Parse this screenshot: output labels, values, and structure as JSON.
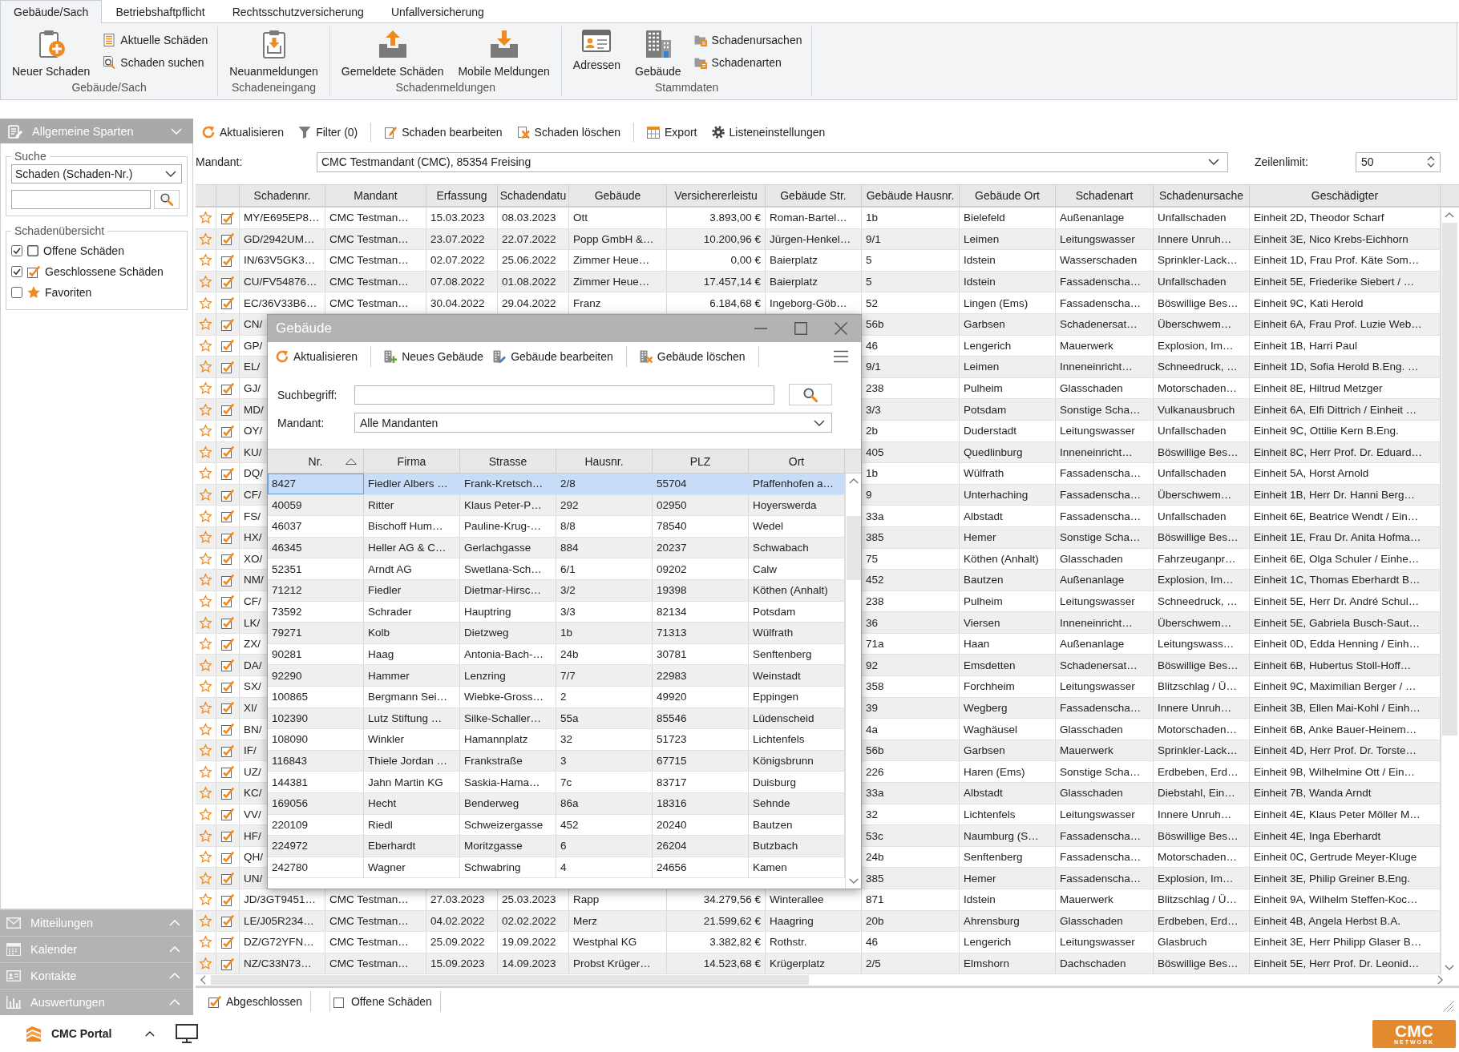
{
  "tabs": [
    {
      "label": "Gebäude/Sach",
      "selected": true
    },
    {
      "label": "Betriebshaftpflicht",
      "selected": false
    },
    {
      "label": "Rechtsschutzversicherung",
      "selected": false
    },
    {
      "label": "Unfallversicherung",
      "selected": false
    }
  ],
  "ribbon": [
    {
      "label": "Gebäude/Sach",
      "buttons": [
        {
          "label": "Neuer Schaden",
          "kind": "large"
        },
        {
          "label": "Aktuelle Schäden",
          "kind": "small"
        },
        {
          "label": "Schaden suchen",
          "kind": "small"
        }
      ]
    },
    {
      "label": "Schadeneingang",
      "buttons": [
        {
          "label": "Neuanmeldungen",
          "kind": "large"
        }
      ]
    },
    {
      "label": "Schadenmeldungen",
      "buttons": [
        {
          "label": "Gemeldete Schäden",
          "kind": "large"
        },
        {
          "label": "Mobile Meldungen",
          "kind": "large"
        }
      ]
    },
    {
      "label": "Stammdaten",
      "buttons": [
        {
          "label": "Adressen",
          "kind": "large"
        },
        {
          "label": "Gebäude",
          "kind": "large"
        },
        {
          "label": "Schadenursachen",
          "kind": "small"
        },
        {
          "label": "Schadenarten",
          "kind": "small"
        }
      ]
    }
  ],
  "sidebar": {
    "title": "Allgemeine Sparten",
    "search": {
      "title": "Suche",
      "field": "Schaden (Schaden-Nr.)"
    },
    "overview": {
      "title": "Schadenübersicht",
      "items": [
        {
          "label": "Offene Schäden",
          "checked": true
        },
        {
          "label": "Geschlossene Schäden",
          "checked": true
        },
        {
          "label": "Favoriten",
          "checked": false
        }
      ]
    },
    "sections": [
      "Mitteilungen",
      "Kalender",
      "Kontakte",
      "Auswertungen"
    ]
  },
  "toolbar": [
    [
      "Aktualisieren",
      "Filter (0)"
    ],
    [
      "Schaden bearbeiten",
      "Schaden löschen"
    ],
    [
      "Export",
      "Listeneinstellungen"
    ]
  ],
  "filter_bar": {
    "mandant_label": "Mandant:",
    "mandant": "CMC Testmandant (CMC), 85354 Freising",
    "row_limit_label": "Zeilenlimit:",
    "row_limit": "50"
  },
  "table": {
    "columns": [
      "Schadennr.",
      "Mandant",
      "Erfassung",
      "Schadendatu",
      "Gebäude",
      "Versichererleistu",
      "Gebäude Str.",
      "Gebäude Hausnr.",
      "Gebäude Ort",
      "Schadenart",
      "Schadenursache",
      "Geschädigter"
    ],
    "rows": [
      {
        "favorite": false,
        "checked": true,
        "kind": "full",
        "cells": [
          "MY/E695EP8…",
          "CMC Testman…",
          "15.03.2023",
          "08.03.2023",
          "Ott",
          "3.893,00 €",
          "Roman-Bartel…",
          "1b",
          "Bielefeld",
          "Außenanlage",
          "Unfallschaden",
          "Einheit 2D, Theodor Scharf"
        ]
      },
      {
        "favorite": false,
        "checked": true,
        "kind": "full",
        "cells": [
          "GD/2942UM…",
          "CMC Testman…",
          "23.07.2022",
          "22.07.2022",
          "Popp GmbH &…",
          "10.200,96 €",
          "Jürgen-Henkel…",
          "9/1",
          "Leimen",
          "Leitungswasser",
          "Innere Unruh…",
          "Einheit 3E, Nico Krebs-Eichhorn"
        ]
      },
      {
        "favorite": false,
        "checked": true,
        "kind": "full",
        "cells": [
          "IN/63V5GK3…",
          "CMC Testman…",
          "02.07.2022",
          "25.06.2022",
          "Zimmer Heue…",
          "0,00 €",
          "Baierplatz",
          "5",
          "Idstein",
          "Wasserschaden",
          "Sprinkler-Lack…",
          "Einheit 1D, Frau Prof. Käte Som…"
        ]
      },
      {
        "favorite": false,
        "checked": true,
        "kind": "full",
        "cells": [
          "CU/FV54876…",
          "CMC Testman…",
          "07.08.2022",
          "01.08.2022",
          "Zimmer Heue…",
          "17.457,14 €",
          "Baierplatz",
          "5",
          "Idstein",
          "Fassadenscha…",
          "Unfallschaden",
          "Einheit 5E, Friederike Siebert / …"
        ]
      },
      {
        "favorite": false,
        "checked": true,
        "kind": "full",
        "cells": [
          "EC/36V33B6…",
          "CMC Testman…",
          "30.04.2022",
          "29.04.2022",
          "Franz",
          "6.184,68 €",
          "Ingeborg-Göb…",
          "52",
          "Lingen (Ems)",
          "Fassadenscha…",
          "Böswillige Bes…",
          "Einheit 9C, Kati Herold"
        ]
      },
      {
        "favorite": false,
        "checked": true,
        "kind": "covered",
        "cells": [
          "CN/",
          "56b",
          "Garbsen",
          "Schadenersat…",
          "Überschwem…",
          "Einheit 6A, Frau Prof. Luzie Web…"
        ]
      },
      {
        "favorite": false,
        "checked": true,
        "kind": "covered",
        "cells": [
          "GP/",
          "46",
          "Lengerich",
          "Mauerwerk",
          "Explosion, Im…",
          "Einheit 1B, Harri Paul"
        ]
      },
      {
        "favorite": false,
        "checked": true,
        "kind": "covered",
        "cells": [
          "EL/",
          "9/1",
          "Leimen",
          "Inneneinricht…",
          "Schneedruck, …",
          "Einheit 1D, Sofia Herold B.Eng. …"
        ]
      },
      {
        "favorite": false,
        "checked": true,
        "kind": "covered",
        "cells": [
          "GJ/",
          "238",
          "Pulheim",
          "Glasschaden",
          "Motorschaden…",
          "Einheit 8E, Hiltrud Metzger"
        ]
      },
      {
        "favorite": false,
        "checked": true,
        "kind": "covered",
        "cells": [
          "MD/",
          "3/3",
          "Potsdam",
          "Sonstige Scha…",
          "Vulkanausbruch",
          "Einheit 6A, Elfi Dittrich / Einheit …"
        ]
      },
      {
        "favorite": false,
        "checked": true,
        "kind": "covered",
        "cells": [
          "OY/",
          "2b",
          "Duderstadt",
          "Leitungswasser",
          "Unfallschaden",
          "Einheit 9C, Ottilie Kern B.Eng."
        ]
      },
      {
        "favorite": false,
        "checked": true,
        "kind": "covered",
        "cells": [
          "KU/",
          "405",
          "Quedlinburg",
          "Inneneinricht…",
          "Böswillige Bes…",
          "Einheit 8C, Herr Prof. Dr. Eduard…"
        ]
      },
      {
        "favorite": false,
        "checked": true,
        "kind": "covered",
        "cells": [
          "DQ/",
          "1b",
          "Wülfrath",
          "Fassadenscha…",
          "Unfallschaden",
          "Einheit 5A, Horst Arnold"
        ]
      },
      {
        "favorite": false,
        "checked": true,
        "kind": "covered",
        "cells": [
          "CF/",
          "9",
          "Unterhaching",
          "Fassadenscha…",
          "Überschwem…",
          "Einheit 1B, Herr Dr. Hanni Berg…"
        ]
      },
      {
        "favorite": false,
        "checked": true,
        "kind": "covered",
        "cells": [
          "FS/",
          "33a",
          "Albstadt",
          "Fassadenscha…",
          "Unfallschaden",
          "Einheit 6E, Beatrice Wendt / Ein…"
        ]
      },
      {
        "favorite": false,
        "checked": true,
        "kind": "covered",
        "cells": [
          "HX/",
          "385",
          "Hemer",
          "Sonstige Scha…",
          "Böswillige Bes…",
          "Einheit 1E, Frau Dr. Anita Hofma…"
        ]
      },
      {
        "favorite": false,
        "checked": true,
        "kind": "covered",
        "cells": [
          "XO/",
          "75",
          "Köthen (Anhalt)",
          "Glasschaden",
          "Fahrzeuganpr…",
          "Einheit 6E, Olga Schuler / Einhe…"
        ]
      },
      {
        "favorite": false,
        "checked": true,
        "kind": "covered",
        "cells": [
          "NM/",
          "452",
          "Bautzen",
          "Außenanlage",
          "Explosion, Im…",
          "Einheit 1C, Thomas Eberhardt B…"
        ]
      },
      {
        "favorite": false,
        "checked": true,
        "kind": "covered",
        "cells": [
          "CF/",
          "238",
          "Pulheim",
          "Leitungswasser",
          "Schneedruck, …",
          "Einheit 5E, Herr Dr. André Schul…"
        ]
      },
      {
        "favorite": false,
        "checked": true,
        "kind": "covered",
        "cells": [
          "LK/",
          "36",
          "Viersen",
          "Inneneinricht…",
          "Überschwem…",
          "Einheit 5E, Gabriela Busch-Saut…"
        ]
      },
      {
        "favorite": false,
        "checked": true,
        "kind": "covered",
        "cells": [
          "ZX/",
          "71a",
          "Haan",
          "Außenanlage",
          "Leitungswass…",
          "Einheit 0D, Edda Henning / Einh…"
        ]
      },
      {
        "favorite": false,
        "checked": true,
        "kind": "covered",
        "cells": [
          "DA/",
          "92",
          "Emsdetten",
          "Schadenersat…",
          "Böswillige Bes…",
          "Einheit 6B, Hubertus Stoll-Hoff…"
        ]
      },
      {
        "favorite": false,
        "checked": true,
        "kind": "covered",
        "cells": [
          "SX/",
          "358",
          "Forchheim",
          "Leitungswasser",
          "Blitzschlag / Ü…",
          "Einheit 9C, Maximilian Berger / …"
        ]
      },
      {
        "favorite": false,
        "checked": true,
        "kind": "covered",
        "cells": [
          "XI/",
          "39",
          "Wegberg",
          "Fassadenscha…",
          "Innere Unruh…",
          "Einheit 3B, Ellen Mai-Kohl / Einh…"
        ]
      },
      {
        "favorite": false,
        "checked": true,
        "kind": "covered",
        "cells": [
          "BN/",
          "4a",
          "Waghäusel",
          "Glasschaden",
          "Motorschaden…",
          "Einheit 6B, Anke Bauer-Heinem…"
        ]
      },
      {
        "favorite": false,
        "checked": true,
        "kind": "covered",
        "cells": [
          "IF/",
          "56b",
          "Garbsen",
          "Mauerwerk",
          "Sprinkler-Lack…",
          "Einheit 4D, Herr Prof. Dr. Torste…"
        ]
      },
      {
        "favorite": false,
        "checked": true,
        "kind": "covered",
        "cells": [
          "UZ/",
          "226",
          "Haren (Ems)",
          "Sonstige Scha…",
          "Erdbeben, Erd…",
          "Einheit 9B, Wilhelmine Ott / Ein…"
        ]
      },
      {
        "favorite": false,
        "checked": true,
        "kind": "covered",
        "cells": [
          "KC/",
          "33a",
          "Albstadt",
          "Glasschaden",
          "Diebstahl, Ein…",
          "Einheit 7B, Wanda Arndt"
        ]
      },
      {
        "favorite": false,
        "checked": true,
        "kind": "covered",
        "cells": [
          "VV/",
          "32",
          "Lichtenfels",
          "Leitungswasser",
          "Innere Unruh…",
          "Einheit 4E, Klaus Peter Möller M…"
        ]
      },
      {
        "favorite": false,
        "checked": true,
        "kind": "covered",
        "cells": [
          "HF/",
          "53c",
          "Naumburg (S…",
          "Fassadenscha…",
          "Böswillige Bes…",
          "Einheit 4E, Inga Eberhardt"
        ]
      },
      {
        "favorite": false,
        "checked": true,
        "kind": "covered",
        "cells": [
          "QH/",
          "24b",
          "Senftenberg",
          "Fassadenscha…",
          "Motorschaden…",
          "Einheit 0C, Gertrude Meyer-Kluge"
        ]
      },
      {
        "favorite": false,
        "checked": true,
        "kind": "covered",
        "cells": [
          "UN/",
          "385",
          "Hemer",
          "Fassadenscha…",
          "Explosion, Im…",
          "Einheit 3E, Philip Greiner B.Eng."
        ]
      },
      {
        "favorite": false,
        "checked": true,
        "kind": "full",
        "cells": [
          "JD/3GT9451…",
          "CMC Testman…",
          "27.03.2023",
          "25.03.2023",
          "Rapp",
          "34.279,56 €",
          "Winterallee",
          "871",
          "Idstein",
          "Mauerwerk",
          "Blitzschlag / Ü…",
          "Einheit 9A, Wilhelm Steffen-Koc…"
        ]
      },
      {
        "favorite": false,
        "checked": true,
        "kind": "full",
        "cells": [
          "LE/J05R234…",
          "CMC Testman…",
          "04.02.2022",
          "02.02.2022",
          "Merz",
          "21.599,62 €",
          "Haagring",
          "20b",
          "Ahrensburg",
          "Glasschaden",
          "Erdbeben, Erd…",
          "Einheit 4B, Angela Herbst B.A."
        ]
      },
      {
        "favorite": false,
        "checked": true,
        "kind": "full",
        "cells": [
          "DZ/G72YFN…",
          "CMC Testman…",
          "25.09.2022",
          "19.09.2022",
          "Westphal KG",
          "3.382,82 €",
          "Rothstr.",
          "46",
          "Lengerich",
          "Leitungswasser",
          "Glasbruch",
          "Einheit 3E, Herr Philipp Glaser B…"
        ]
      },
      {
        "favorite": false,
        "checked": true,
        "kind": "full",
        "cells": [
          "NZ/C33N73…",
          "CMC Testman…",
          "15.09.2023",
          "14.09.2023",
          "Probst Krüger…",
          "14.523,68 €",
          "Krügerplatz",
          "2/5",
          "Elmshorn",
          "Dachschaden",
          "Böswillige Bes…",
          "Einheit 5E, Herr Prof. Dr. Leonid…"
        ]
      }
    ]
  },
  "status_bar": [
    {
      "label": "Abgeschlossen",
      "checked": true
    },
    {
      "label": "Offene Schäden",
      "checked": false
    }
  ],
  "dialog": {
    "title": "Gebäude",
    "toolbar": [
      [
        "Aktualisieren"
      ],
      [
        "Neues Gebäude",
        "Gebäude bearbeiten"
      ],
      [
        "Gebäude löschen"
      ]
    ],
    "search_label": "Suchbegriff:",
    "mandant_label": "Mandant:",
    "mandant": "Alle Mandanten",
    "table": {
      "columns": [
        {
          "label": "Nr.",
          "sorted": true
        },
        {
          "label": "Firma",
          "sorted": false
        },
        {
          "label": "Strasse",
          "sorted": false
        },
        {
          "label": "Hausnr.",
          "sorted": false
        },
        {
          "label": "PLZ",
          "sorted": false
        },
        {
          "label": "Ort",
          "sorted": false
        }
      ],
      "rows": [
        {
          "selected": true,
          "cells": [
            "8427",
            "Fiedler Albers …",
            "Frank-Kretsch…",
            "2/8",
            "55704",
            "Pfaffenhofen a…"
          ]
        },
        {
          "selected": false,
          "cells": [
            "40059",
            "Ritter",
            "Klaus Peter-P…",
            "292",
            "02950",
            "Hoyerswerda"
          ]
        },
        {
          "selected": false,
          "cells": [
            "46037",
            "Bischoff Hum…",
            "Pauline-Krug-…",
            "8/8",
            "78540",
            "Wedel"
          ]
        },
        {
          "selected": false,
          "cells": [
            "46345",
            "Heller AG & C…",
            "Gerlachgasse",
            "884",
            "20237",
            "Schwabach"
          ]
        },
        {
          "selected": false,
          "cells": [
            "52351",
            "Arndt AG",
            "Swetlana-Sch…",
            "6/1",
            "09202",
            "Calw"
          ]
        },
        {
          "selected": false,
          "cells": [
            "71212",
            "Fiedler",
            "Dietmar-Hirsc…",
            "3/2",
            "19398",
            "Köthen (Anhalt)"
          ]
        },
        {
          "selected": false,
          "cells": [
            "73592",
            "Schrader",
            "Hauptring",
            "3/3",
            "82134",
            "Potsdam"
          ]
        },
        {
          "selected": false,
          "cells": [
            "79271",
            "Kolb",
            "Dietzweg",
            "1b",
            "71313",
            "Wülfrath"
          ]
        },
        {
          "selected": false,
          "cells": [
            "90281",
            "Haag",
            "Antonia-Bach-…",
            "24b",
            "30781",
            "Senftenberg"
          ]
        },
        {
          "selected": false,
          "cells": [
            "92290",
            "Hammer",
            "Lenzring",
            "7/7",
            "22983",
            "Weinstadt"
          ]
        },
        {
          "selected": false,
          "cells": [
            "100865",
            "Bergmann Sei…",
            "Wiebke-Gross…",
            "2",
            "49920",
            "Eppingen"
          ]
        },
        {
          "selected": false,
          "cells": [
            "102390",
            "Lutz Stiftung …",
            "Silke-Schaller…",
            "55a",
            "85546",
            "Lüdenscheid"
          ]
        },
        {
          "selected": false,
          "cells": [
            "108090",
            "Winkler",
            "Hamannplatz",
            "32",
            "51723",
            "Lichtenfels"
          ]
        },
        {
          "selected": false,
          "cells": [
            "116843",
            "Thiele Jordan …",
            "Frankstraße",
            "3",
            "67715",
            "Königsbrunn"
          ]
        },
        {
          "selected": false,
          "cells": [
            "144381",
            "Jahn Martin KG",
            "Saskia-Hama…",
            "7c",
            "83717",
            "Duisburg"
          ]
        },
        {
          "selected": false,
          "cells": [
            "169056",
            "Hecht",
            "Benderweg",
            "86a",
            "18316",
            "Sehnde"
          ]
        },
        {
          "selected": false,
          "cells": [
            "220109",
            "Riedl",
            "Schweizergasse",
            "452",
            "20240",
            "Bautzen"
          ]
        },
        {
          "selected": false,
          "cells": [
            "224972",
            "Eberhardt",
            "Moritzgasse",
            "6",
            "26204",
            "Butzbach"
          ]
        },
        {
          "selected": false,
          "cells": [
            "242780",
            "Wagner",
            "Schwabring",
            "4",
            "24656",
            "Kamen"
          ]
        }
      ]
    }
  },
  "footer": {
    "app_name": "CMC Portal",
    "logo": "CMC",
    "logo_tagline": "NETWORK"
  }
}
